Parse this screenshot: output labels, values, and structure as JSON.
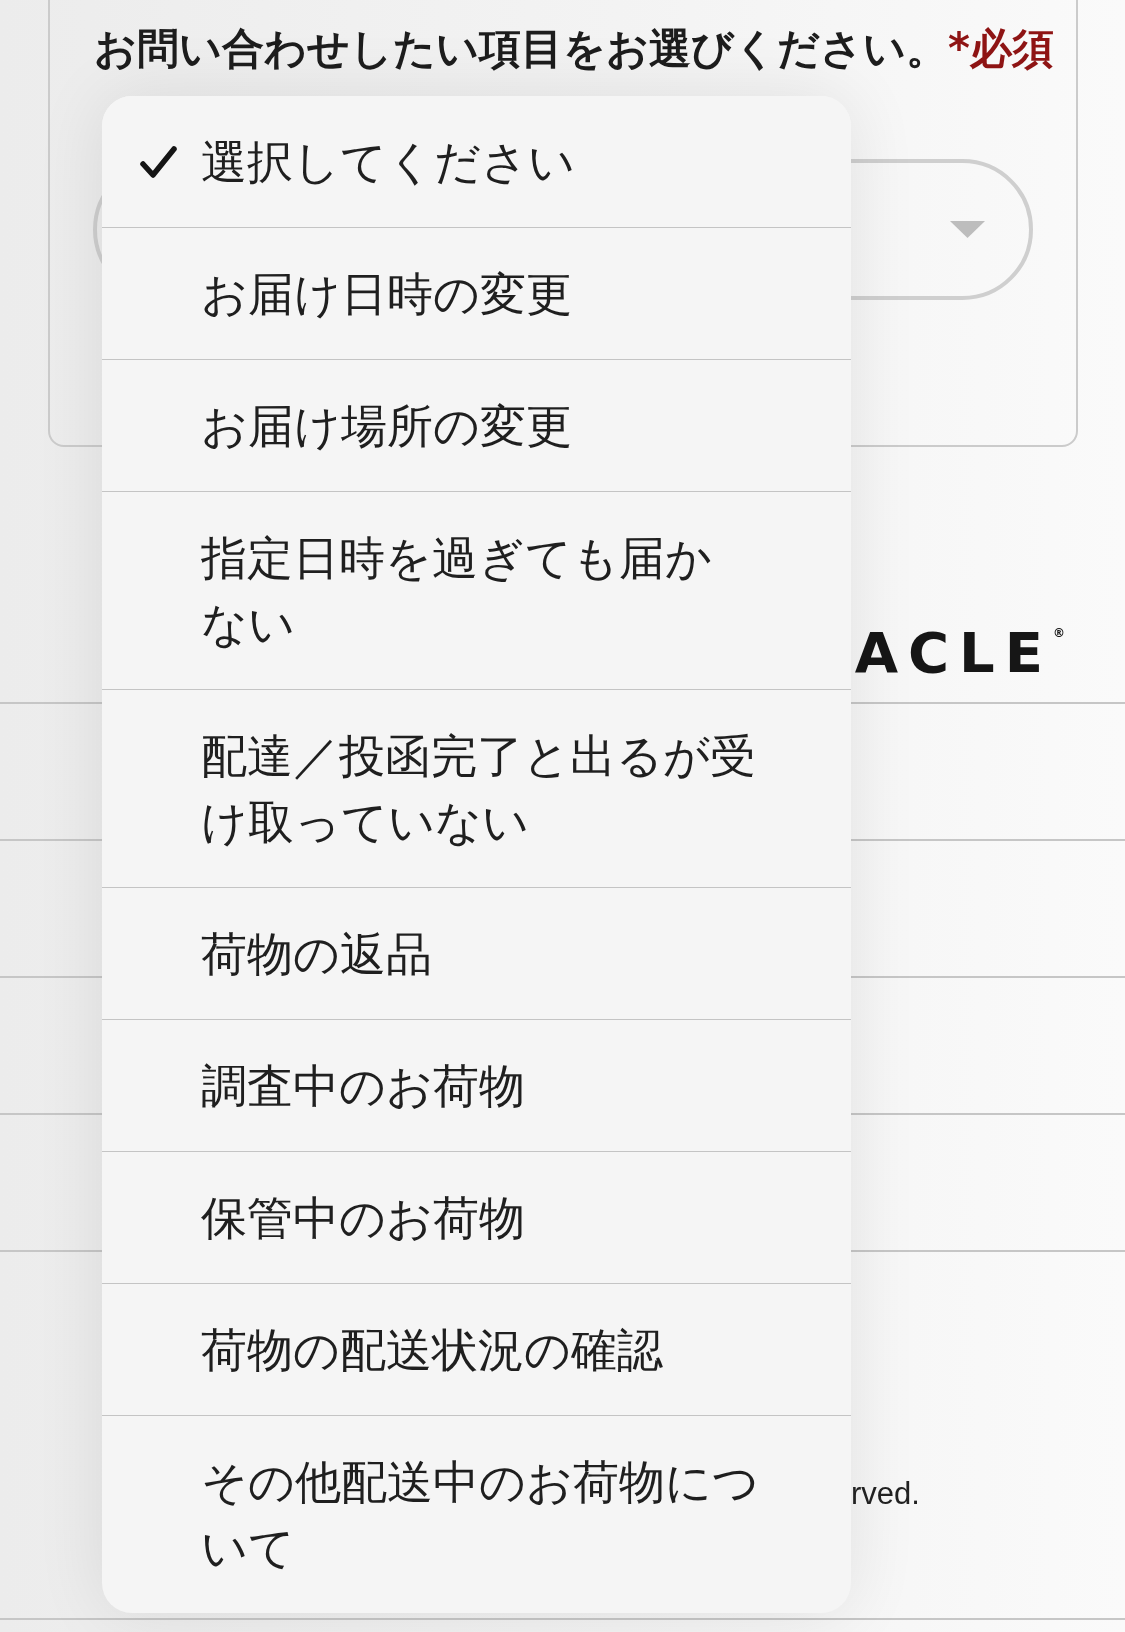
{
  "form": {
    "question": "お問い合わせしたい項目をお選びください。",
    "required_mark": "*必須"
  },
  "logo": {
    "text": "ACLE$^{®}$"
  },
  "footer": {
    "copyright": "rved."
  },
  "dropdown": {
    "options": [
      {
        "label": "選択してください",
        "selected": true
      },
      {
        "label": "お届け日時の変更",
        "selected": false
      },
      {
        "label": "お届け場所の変更",
        "selected": false
      },
      {
        "label": "指定日時を過ぎても届かない",
        "selected": false
      },
      {
        "label": "配達／投函完了と出るが受け取っていない",
        "selected": false
      },
      {
        "label": "荷物の返品",
        "selected": false
      },
      {
        "label": "調査中のお荷物",
        "selected": false
      },
      {
        "label": "保管中のお荷物",
        "selected": false
      },
      {
        "label": "荷物の配送状況の確認",
        "selected": false
      },
      {
        "label": "その他配送中のお荷物について",
        "selected": false
      }
    ]
  }
}
